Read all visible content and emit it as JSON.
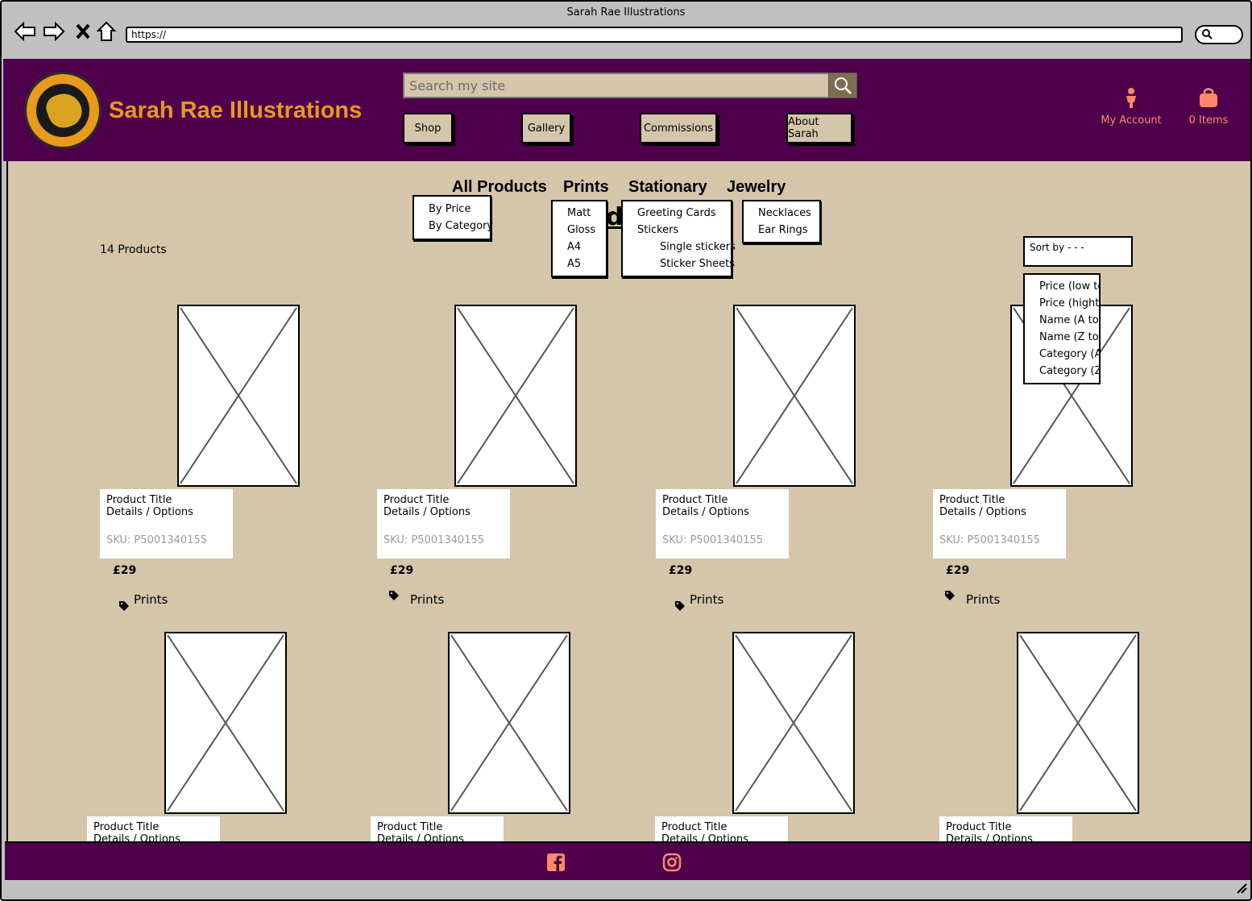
{
  "window": {
    "title": "Sarah Rae Illustrations",
    "url": "https://"
  },
  "icons": {
    "back": "back-arrow-icon",
    "forward": "forward-arrow-icon",
    "stop": "close-icon",
    "home": "home-icon",
    "search": "search-icon",
    "account": "person-icon",
    "cart": "shopping-bag-icon",
    "tag": "tag-icon",
    "facebook": "facebook-icon",
    "instagram": "instagram-icon"
  },
  "colors": {
    "brand_purple": "#4f004c",
    "brand_gold": "#e79a1b",
    "header_link": "#ff8a65",
    "content_bg": "#d4c5ab"
  },
  "header": {
    "site_title": "Sarah Rae Illustrations",
    "search_placeholder": "Search my site",
    "nav": [
      "Shop",
      "Gallery",
      "Commissions",
      "About Sarah"
    ],
    "account_label": "My Account",
    "cart_label": "0 Items"
  },
  "categories": {
    "items": [
      "All Products",
      "Prints",
      "Stationary",
      "Jewelry"
    ],
    "all_products_menu": [
      "By Price",
      "By Category"
    ],
    "prints_menu": [
      "Matt",
      "Gloss",
      "A4",
      "A5"
    ],
    "stationary_menu": [
      "Greeting Cards",
      "Stickers",
      "Single stickers",
      "Sticker Sheets"
    ],
    "jewelry_menu": [
      "Necklaces",
      "Ear Rings"
    ]
  },
  "listing": {
    "count": "14 Products",
    "sort_label": "Sort by - - -",
    "sort_options": [
      "Price (low to",
      "Price (hight",
      "Name (A to",
      "Name (Z to",
      "Category (A",
      "Category (Z"
    ]
  },
  "products": [
    {
      "title": "Product Title",
      "details": "Details / Options",
      "sku": "SKU: P5001340155",
      "price": "£29",
      "tag": "Prints"
    },
    {
      "title": "Product Title",
      "details": "Details / Options",
      "sku": "SKU: P5001340155",
      "price": "£29",
      "tag": "Prints"
    },
    {
      "title": "Product Title",
      "details": "Details / Options",
      "sku": "SKU: P5001340155",
      "price": "£29",
      "tag": "Prints"
    },
    {
      "title": "Product Title",
      "details": "Details / Options",
      "sku": "SKU: P5001340155",
      "price": "£29",
      "tag": "Prints"
    },
    {
      "title": "Product Title",
      "details": "Details / Options"
    },
    {
      "title": "Product Title",
      "details": "Details / Options"
    },
    {
      "title": "Product Title",
      "details": "Details / Options"
    },
    {
      "title": "Product Title",
      "details": "Details / Options"
    }
  ]
}
